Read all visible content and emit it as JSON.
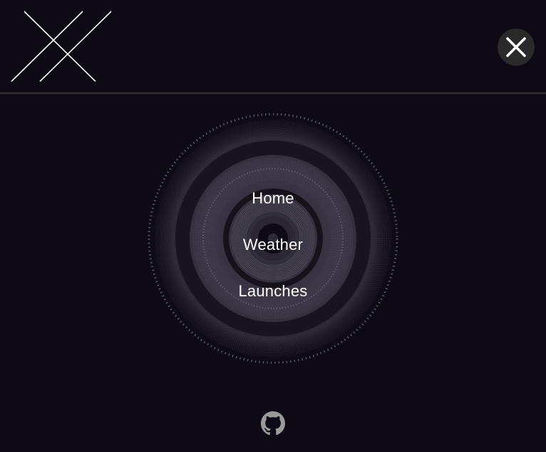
{
  "header": {
    "logo_icon": "spacex-x-logo-icon",
    "close_icon": "close-icon"
  },
  "nav": {
    "items": [
      {
        "label": "Home"
      },
      {
        "label": "Weather"
      },
      {
        "label": "Launches"
      }
    ]
  },
  "footer": {
    "github_icon": "github-icon"
  },
  "colors": {
    "background": "#0d0a16",
    "divider": "#2b2830",
    "close_button_bg": "#2a2a2a",
    "text": "#ffffff",
    "icon_gray": "#9a9a9a"
  }
}
